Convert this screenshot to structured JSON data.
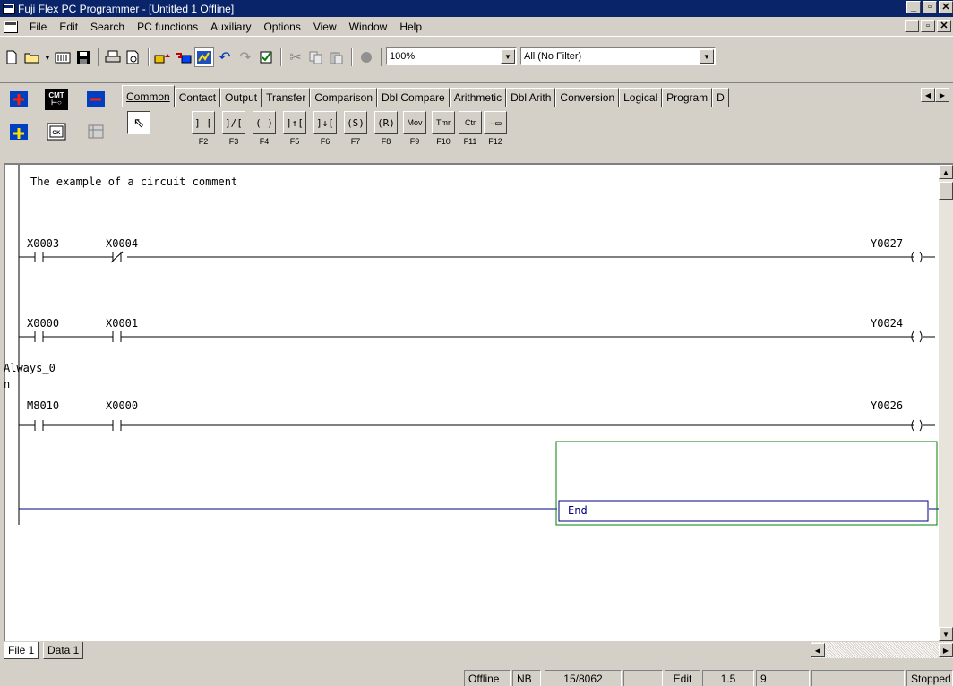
{
  "window": {
    "title": "Fuji Flex PC Programmer - [Untitled 1 Offline]",
    "buttons": [
      "_",
      " ",
      "X"
    ]
  },
  "menu": [
    "File",
    "Edit",
    "Search",
    "PC functions",
    "Auxiliary",
    "Options",
    "View",
    "Window",
    "Help"
  ],
  "toolbar": {
    "zoom": "100%",
    "filter": "All (No Filter)"
  },
  "palette": {
    "tabs": [
      "Common",
      "Contact",
      "Output",
      "Transfer",
      "Comparison",
      "Dbl Compare",
      "Arithmetic",
      "Dbl Arith",
      "Conversion",
      "Logical",
      "Program",
      "D"
    ],
    "left_buttons": [
      "CMT",
      "LD OK"
    ],
    "instructions": [
      {
        "glyph": "] [",
        "key": "F2"
      },
      {
        "glyph": "]/[",
        "key": "F3"
      },
      {
        "glyph": "( )",
        "key": "F4"
      },
      {
        "glyph": "]↑[",
        "key": "F5"
      },
      {
        "glyph": "]↓[",
        "key": "F6"
      },
      {
        "glyph": "(S)",
        "key": "F7"
      },
      {
        "glyph": "(R)",
        "key": "F8"
      },
      {
        "glyph": "Mov",
        "key": "F9"
      },
      {
        "glyph": "Tmr",
        "key": "F10"
      },
      {
        "glyph": "Ctr",
        "key": "F11"
      },
      {
        "glyph": "—▭",
        "key": "F12"
      }
    ]
  },
  "ladder": {
    "comment": "The example of a circuit comment",
    "rungs": [
      {
        "contact1": "X0003",
        "contact2": "X0004",
        "coil": "Y0027",
        "contact2_type": "nc"
      },
      {
        "contact1": "X0000",
        "contact2": "X0001",
        "coil": "Y0024",
        "contact2_type": "no"
      },
      {
        "label": "Always_0",
        "label2": "n",
        "contact1": "M8010",
        "contact2": "X0000",
        "coil": "Y0026",
        "contact2_type": "no"
      }
    ],
    "end_label": "End"
  },
  "file_tabs": [
    "File 1",
    "Data 1"
  ],
  "status": {
    "mode": "Offline",
    "nb": "NB",
    "steps": "15/8062",
    "edit": "Edit",
    "pos": "1.5",
    "col": "9",
    "run": "Stopped"
  }
}
